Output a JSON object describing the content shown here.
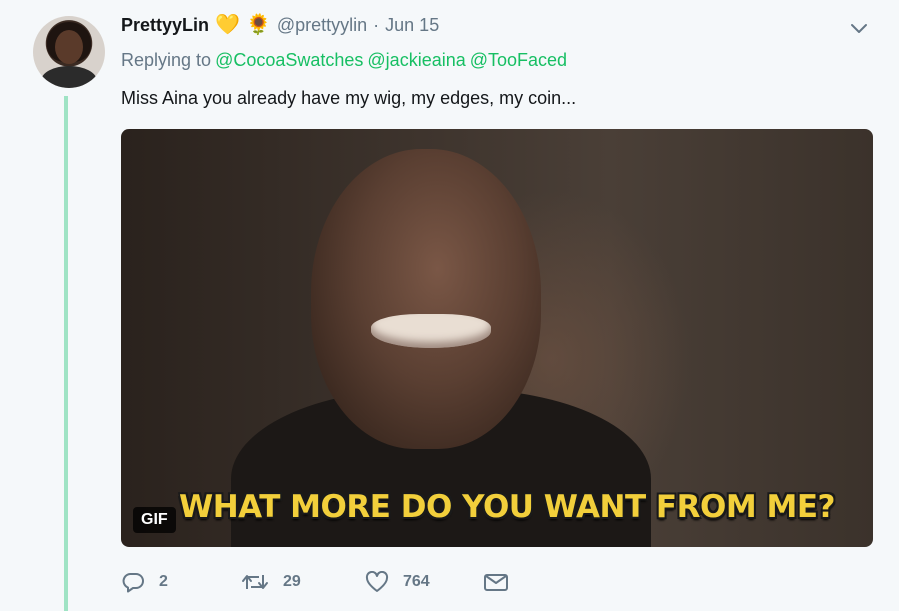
{
  "user": {
    "name": "PrettyyLin",
    "emojis": [
      "💛",
      "🌻"
    ],
    "handle": "@prettyylin",
    "separator": "·",
    "date": "Jun 15"
  },
  "replying": {
    "label": "Replying to",
    "mentions": [
      "@CocoaSwatches",
      "@jackieaina",
      "@TooFaced"
    ]
  },
  "tweet_text": "Miss Aina you already have my wig, my edges, my coin...",
  "media": {
    "caption": "WHAT MORE DO YOU WANT FROM ME?",
    "badge": "GIF"
  },
  "actions": {
    "replies": "2",
    "retweets": "29",
    "likes": "764"
  },
  "icons": {
    "menu": "chevron-down-icon",
    "reply": "reply-icon",
    "retweet": "retweet-icon",
    "like": "heart-icon",
    "dm": "envelope-icon"
  },
  "colors": {
    "accent_mention": "#17bf63",
    "thread_line": "#9fe3c4",
    "muted_text": "#657786",
    "background": "#f5f8fa"
  }
}
